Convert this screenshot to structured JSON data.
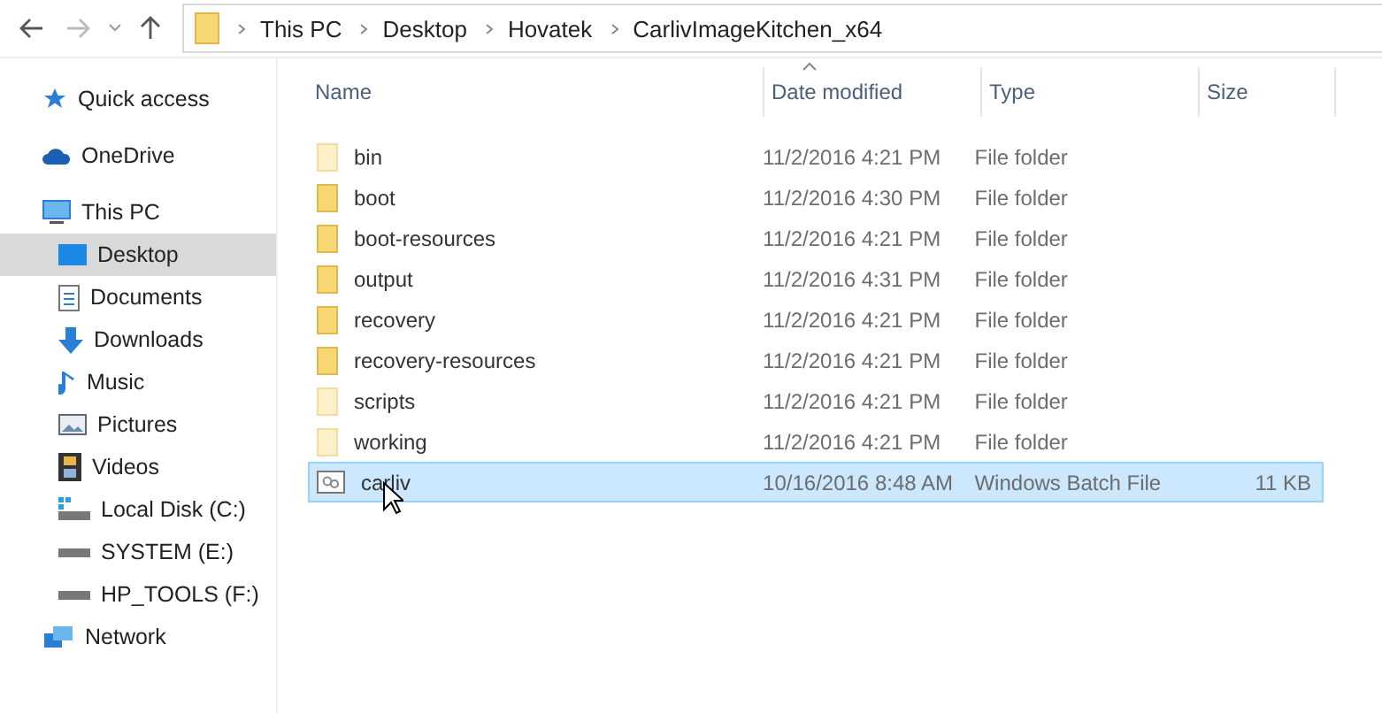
{
  "breadcrumb": [
    "This PC",
    "Desktop",
    "Hovatek",
    "CarlivImageKitchen_x64"
  ],
  "sidebar": {
    "items": [
      {
        "label": "Quick access",
        "kind": "star",
        "selected": false
      },
      {
        "label": "OneDrive",
        "kind": "cloud",
        "selected": false
      },
      {
        "label": "This PC",
        "kind": "pc",
        "selected": false,
        "children": [
          {
            "label": "Desktop",
            "kind": "desktop",
            "selected": true
          },
          {
            "label": "Documents",
            "kind": "document",
            "selected": false
          },
          {
            "label": "Downloads",
            "kind": "download",
            "selected": false
          },
          {
            "label": "Music",
            "kind": "music",
            "selected": false
          },
          {
            "label": "Pictures",
            "kind": "picture",
            "selected": false
          },
          {
            "label": "Videos",
            "kind": "video",
            "selected": false
          },
          {
            "label": "Local Disk (C:)",
            "kind": "system-disk",
            "selected": false
          },
          {
            "label": "SYSTEM (E:)",
            "kind": "disk",
            "selected": false
          },
          {
            "label": "HP_TOOLS (F:)",
            "kind": "disk",
            "selected": false
          }
        ]
      },
      {
        "label": "Network",
        "kind": "network",
        "selected": false
      }
    ]
  },
  "table": {
    "columns": [
      "Name",
      "Date modified",
      "Type",
      "Size"
    ],
    "rows": [
      {
        "name": "bin",
        "date": "11/2/2016 4:21 PM",
        "type": "File folder",
        "kind": "folder",
        "empty": true,
        "selected": false
      },
      {
        "name": "boot",
        "date": "11/2/2016 4:30 PM",
        "type": "File folder",
        "kind": "folder",
        "empty": false,
        "selected": false
      },
      {
        "name": "boot-resources",
        "date": "11/2/2016 4:21 PM",
        "type": "File folder",
        "kind": "folder",
        "empty": false,
        "selected": false
      },
      {
        "name": "output",
        "date": "11/2/2016 4:31 PM",
        "type": "File folder",
        "kind": "folder",
        "empty": false,
        "selected": false
      },
      {
        "name": "recovery",
        "date": "11/2/2016 4:21 PM",
        "type": "File folder",
        "kind": "folder",
        "empty": false,
        "selected": false
      },
      {
        "name": "recovery-resources",
        "date": "11/2/2016 4:21 PM",
        "type": "File folder",
        "kind": "folder",
        "empty": false,
        "selected": false
      },
      {
        "name": "scripts",
        "date": "11/2/2016 4:21 PM",
        "type": "File folder",
        "kind": "folder",
        "empty": true,
        "selected": false
      },
      {
        "name": "working",
        "date": "11/2/2016 4:21 PM",
        "type": "File folder",
        "kind": "folder",
        "empty": true,
        "selected": false
      },
      {
        "name": "carliv",
        "date": "10/16/2016 8:48 AM",
        "type": "Windows Batch File",
        "size": "11 KB",
        "kind": "batch",
        "selected": true
      }
    ]
  }
}
